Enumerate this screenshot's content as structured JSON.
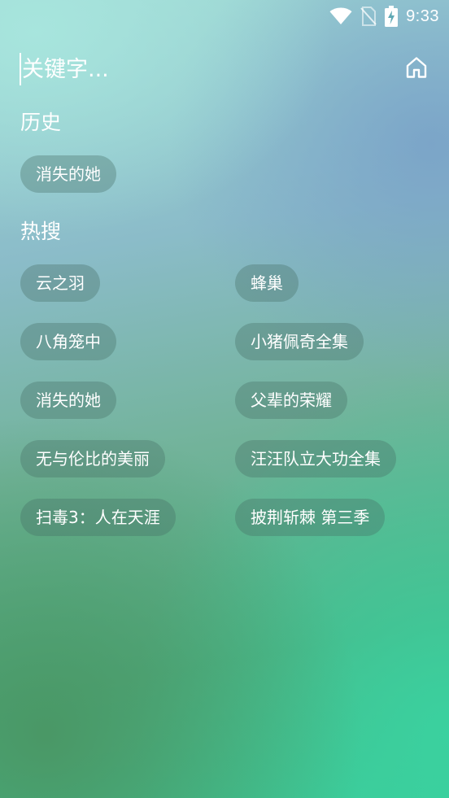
{
  "status_bar": {
    "time": "9:33",
    "icons": [
      "wifi-icon",
      "no-sim-icon",
      "battery-charging-icon"
    ]
  },
  "search": {
    "placeholder": "关键字...",
    "home_icon": "home-icon"
  },
  "history": {
    "title": "历史",
    "items": [
      "消失的她"
    ]
  },
  "hot": {
    "title": "热搜",
    "left": [
      "云之羽",
      "八角笼中",
      "消失的她",
      "无与伦比的美丽",
      "扫毒3：人在天涯"
    ],
    "right": [
      "蜂巢",
      "小猪佩奇全集",
      "父辈的荣耀",
      "汪汪队立大功全集",
      "披荆斩棘 第三季"
    ]
  }
}
